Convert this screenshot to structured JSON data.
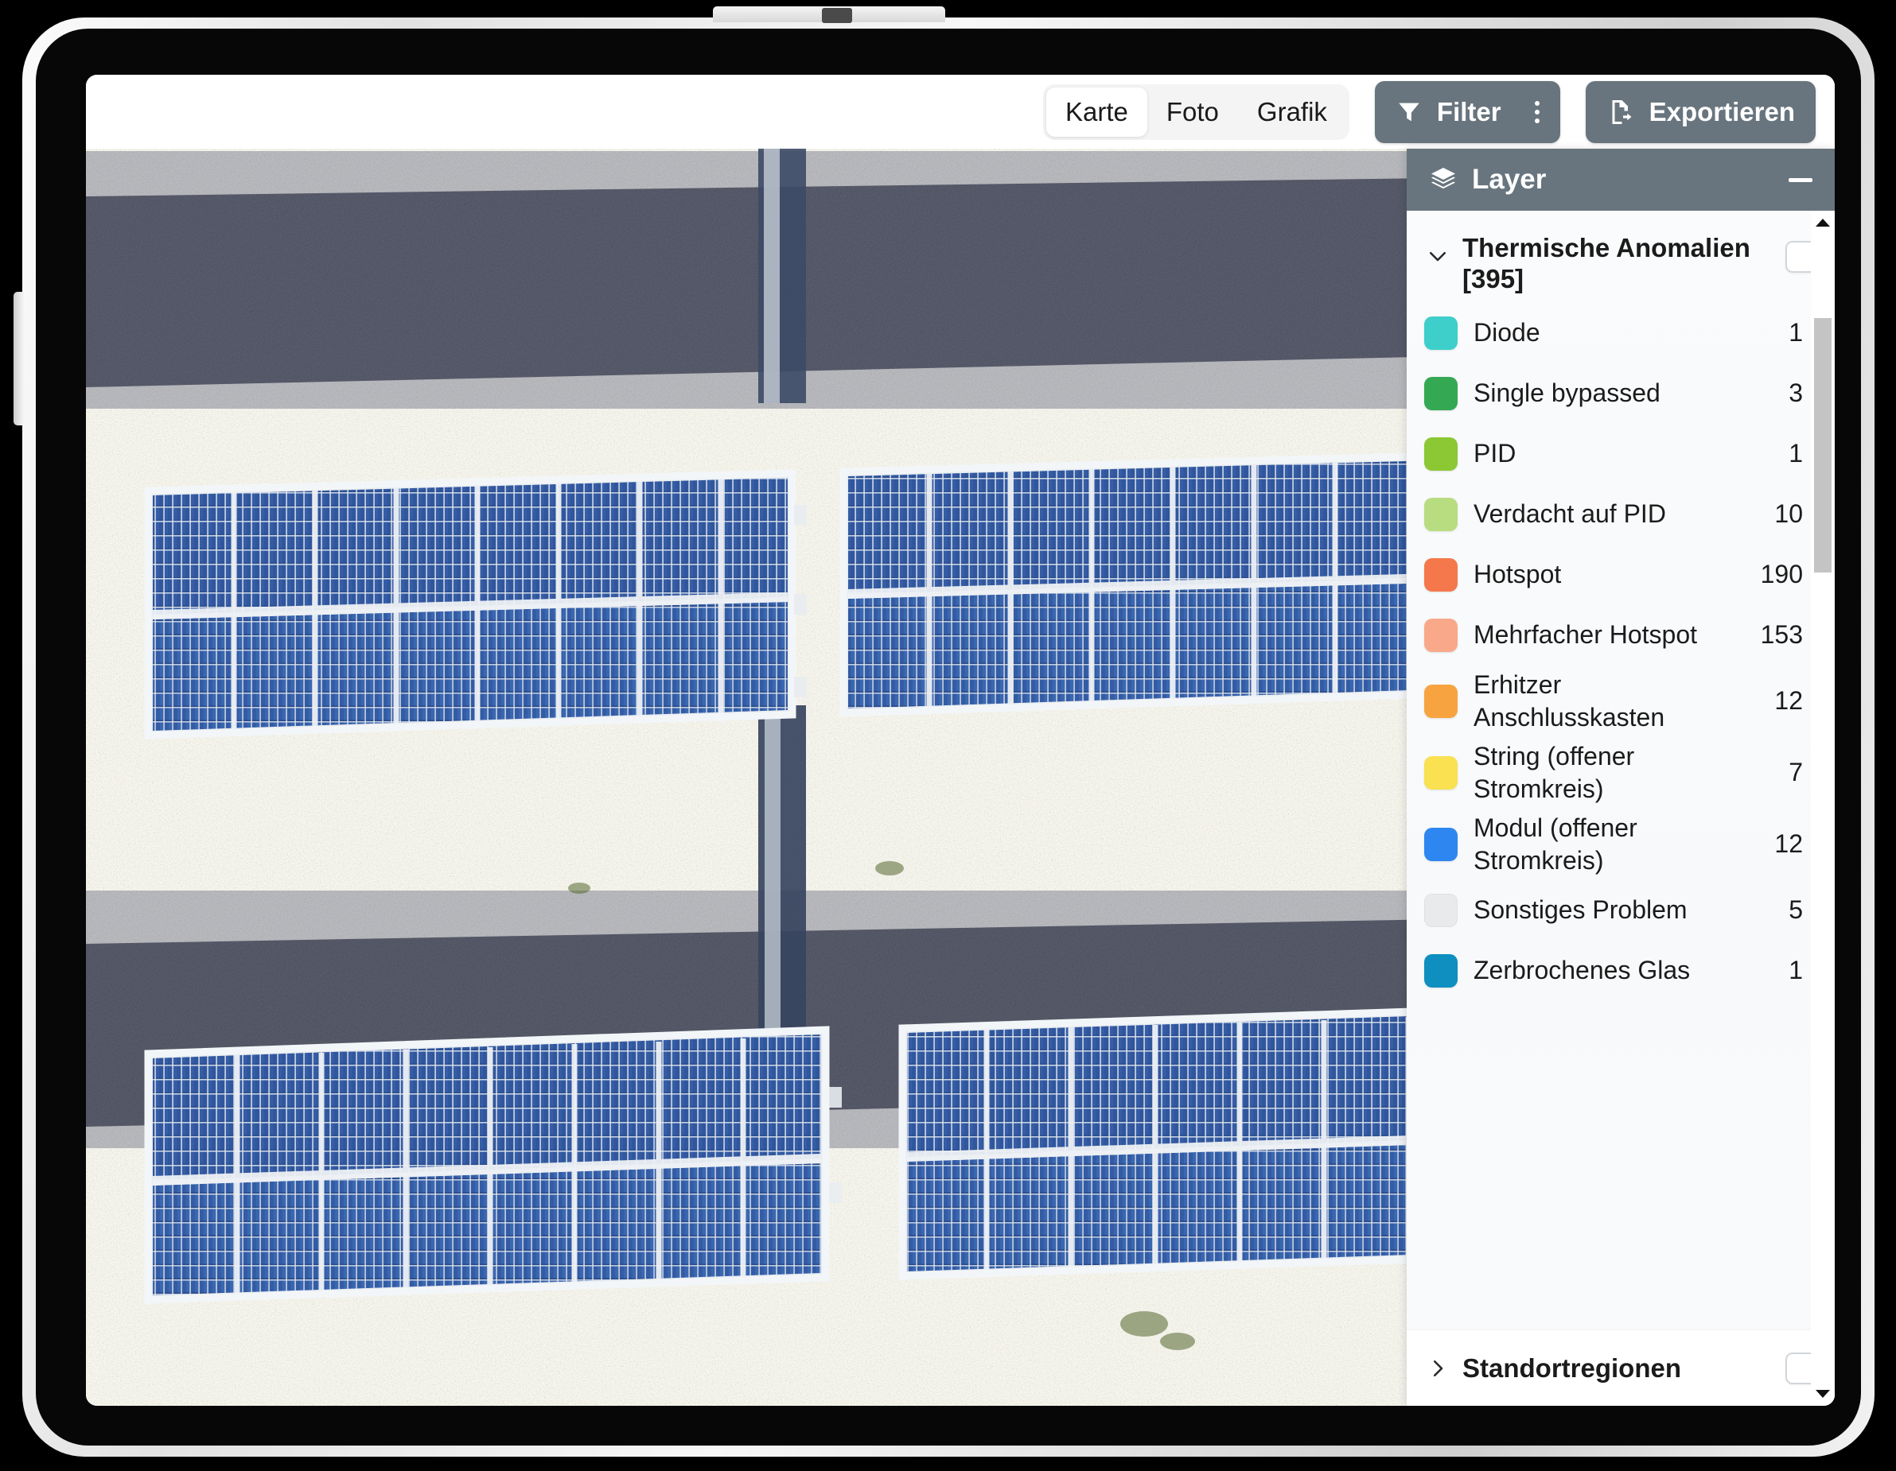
{
  "toolbar": {
    "tabs": [
      {
        "label": "Karte",
        "active": true
      },
      {
        "label": "Foto",
        "active": false
      },
      {
        "label": "Grafik",
        "active": false
      }
    ],
    "filter_label": "Filter",
    "export_label": "Exportieren",
    "filter_icon": "funnel-icon",
    "kebab_icon": "more-vertical-icon",
    "export_icon": "file-export-icon"
  },
  "layer_panel": {
    "header_title": "Layer",
    "header_icon": "layers-icon",
    "minimize_icon": "minimize-icon",
    "header_bg": "#68757e",
    "group": {
      "title": "Thermische Anomalien [395]",
      "expanded": true,
      "chevron_icon": "chevron-down-icon",
      "checked": false,
      "total": 395,
      "items": [
        {
          "color": "#3ecfca",
          "label": "Diode",
          "count": "1"
        },
        {
          "color": "#34a853",
          "label": "Single bypassed",
          "count": "3"
        },
        {
          "color": "#8bc834",
          "label": "PID",
          "count": "1"
        },
        {
          "color": "#b8dd81",
          "label": "Verdacht auf PID",
          "count": "10"
        },
        {
          "color": "#f4784c",
          "label": "Hotspot",
          "count": "190"
        },
        {
          "color": "#f9a98a",
          "label": "Mehrfacher Hotspot",
          "count": "153"
        },
        {
          "color": "#f7a440",
          "label": "Erhitzer Anschlusskasten",
          "count": "12"
        },
        {
          "color": "#f9e152",
          "label": "String (offener Stromkreis)",
          "count": "7"
        },
        {
          "color": "#2e86f0",
          "label": "Modul (offener Stromkreis)",
          "count": "12"
        },
        {
          "color": "#e9eaec",
          "label": "Sonstiges Problem",
          "count": "5"
        },
        {
          "color": "#0e8fbf",
          "label": "Zerbrochenes Glas",
          "count": "1"
        }
      ]
    },
    "group2": {
      "title": "Standortregionen",
      "expanded": false,
      "chevron_icon": "chevron-right-icon",
      "checked": false
    },
    "scrollbar": {
      "up_icon": "caret-up-icon",
      "down_icon": "caret-down-icon"
    }
  },
  "map": {
    "type": "aerial-orthomosaic",
    "description": "Luftbild Solarpark"
  }
}
